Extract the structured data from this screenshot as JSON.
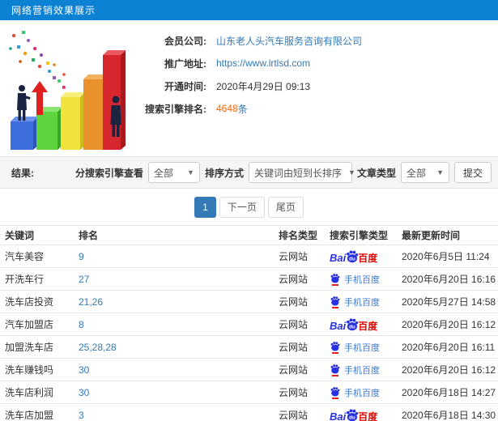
{
  "header": {
    "title": "网络营销效果展示"
  },
  "info": {
    "rows": [
      {
        "label": "会员公司:",
        "value": "山东老人头汽车服务咨询有限公司"
      },
      {
        "label": "推广地址:",
        "value": "https://www.lrtlsd.com"
      },
      {
        "label": "开通时间:",
        "value": "2020年4月29日 09:13"
      },
      {
        "label": "搜索引擎排名:",
        "value": "4648",
        "suffix": "条"
      }
    ]
  },
  "filter": {
    "result_label": "结果:",
    "engine_label": "分搜索引擎查看",
    "engine_value": "全部",
    "sort_label": "排序方式",
    "sort_value": "关键词由短到长排序",
    "article_label": "文章类型",
    "article_value": "全部",
    "submit_label": "提交"
  },
  "pagination": {
    "current": "1",
    "next": "下一页",
    "last": "尾页"
  },
  "table": {
    "headers": [
      "关键词",
      "排名",
      "排名类型",
      "搜索引擎类型",
      "最新更新时间"
    ],
    "rows": [
      {
        "keyword": "汽车美容",
        "rank": "9",
        "rank_type": "云网站",
        "engine": "baidu",
        "updated": "2020年6月5日 11:24"
      },
      {
        "keyword": "开洗车行",
        "rank": "27",
        "rank_type": "云网站",
        "engine": "mobile-baidu",
        "updated": "2020年6月20日 16:16"
      },
      {
        "keyword": "洗车店投资",
        "rank": "21,26",
        "rank_type": "云网站",
        "engine": "mobile-baidu",
        "updated": "2020年5月27日 14:58"
      },
      {
        "keyword": "汽车加盟店",
        "rank": "8",
        "rank_type": "云网站",
        "engine": "baidu",
        "updated": "2020年6月20日 16:12"
      },
      {
        "keyword": "加盟洗车店",
        "rank": "25,28,28",
        "rank_type": "云网站",
        "engine": "mobile-baidu",
        "updated": "2020年6月20日 16:11"
      },
      {
        "keyword": "洗车赚钱吗",
        "rank": "30",
        "rank_type": "云网站",
        "engine": "mobile-baidu",
        "updated": "2020年6月20日 16:12"
      },
      {
        "keyword": "洗车店利润",
        "rank": "30",
        "rank_type": "云网站",
        "engine": "mobile-baidu",
        "updated": "2020年6月18日 14:27"
      },
      {
        "keyword": "洗车店加盟",
        "rank": "3",
        "rank_type": "云网站",
        "engine": "baidu",
        "updated": "2020年6月18日 14:30"
      }
    ],
    "engine_labels": {
      "baidu": {
        "bai": "Bai",
        "du": "du",
        "cn": "百度"
      },
      "mobile_baidu": {
        "text": "手机百度"
      }
    }
  },
  "colors": {
    "accent": "#0e82d2",
    "link": "#337ab7",
    "highlight": "#f60",
    "baidu_blue": "#2932e1",
    "baidu_red": "#e10601",
    "mobile_baidu_blue": "#3b7ad3"
  }
}
